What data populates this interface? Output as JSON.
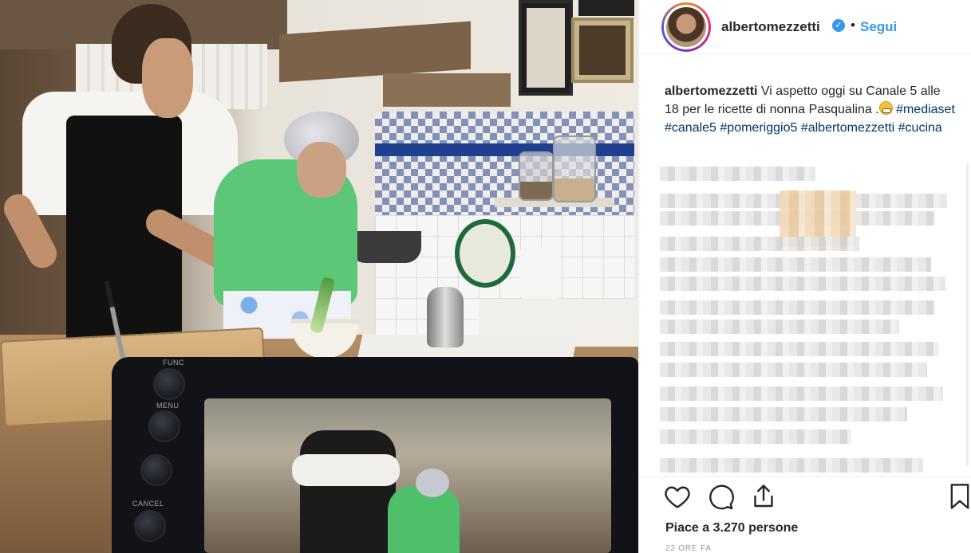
{
  "post": {
    "username": "albertomezzetti",
    "follow_label": "Segui",
    "separator": "•",
    "caption": {
      "user": "albertomezzetti",
      "text": "Vi aspetto oggi su Canale 5 alle 18 per le ricette di nonna Pasqualina .",
      "hashtags": [
        "#mediaset",
        "#canale5",
        "#pomeriggio5",
        "#albertomezzetti",
        "#cucina"
      ]
    },
    "likes_text": "Piace a 3.270 persone",
    "timestamp": "22 ORE FA"
  },
  "camera": {
    "labels": [
      "FUNC",
      "MENU",
      "CANCEL"
    ]
  },
  "icons": {
    "like": "heart-icon",
    "comment": "comment-icon",
    "share": "share-icon",
    "save": "bookmark-icon",
    "verified": "verified-badge-icon",
    "emoji": "grinning-face-emoji"
  },
  "colors": {
    "link": "#3897f0",
    "hashtag": "#003569",
    "text": "#262626",
    "verified": "#3897f0"
  }
}
